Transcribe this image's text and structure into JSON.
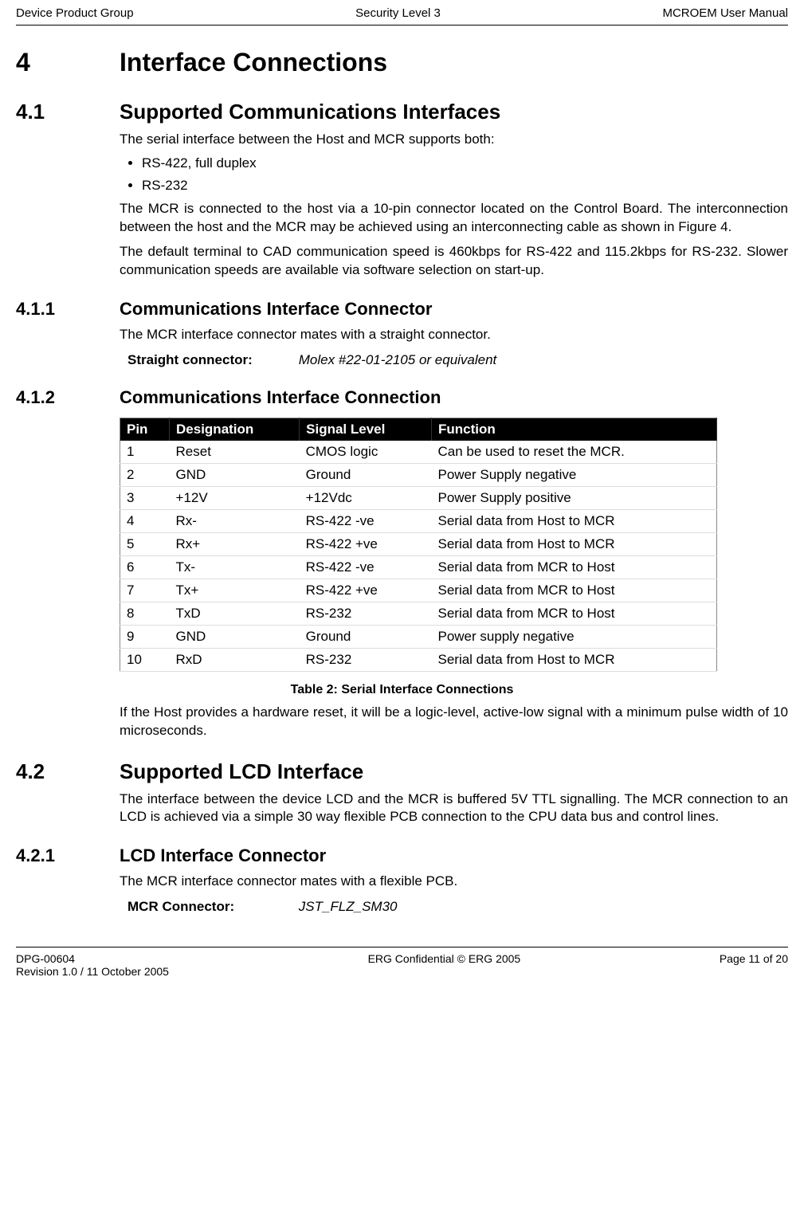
{
  "header": {
    "left": "Device Product Group",
    "center": "Security Level 3",
    "right": "MCROEM User Manual"
  },
  "s4": {
    "num": "4",
    "title": "Interface Connections"
  },
  "s41": {
    "num": "4.1",
    "title": "Supported Communications Interfaces"
  },
  "p41_1": "The serial interface between the Host and MCR supports both:",
  "bullet1": "RS-422, full duplex",
  "bullet2": "RS-232",
  "p41_2": "The MCR is connected to the host via a 10-pin connector located on the Control Board.  The interconnection between the host and the MCR may be achieved using an interconnecting cable as shown in Figure 4.",
  "p41_3": "The default terminal to CAD communication speed is 460kbps for RS-422 and 115.2kbps for RS-232. Slower communication speeds are available via software selection on start-up.",
  "s411": {
    "num": "4.1.1",
    "title": "Communications Interface Connector"
  },
  "p411_1": "The MCR interface connector mates with a straight connector.",
  "spec411": {
    "label": "Straight connector:",
    "value": "Molex #22-01-2105 or equivalent"
  },
  "s412": {
    "num": "4.1.2",
    "title": "Communications Interface Connection"
  },
  "table": {
    "headers": {
      "pin": "Pin",
      "des": "Designation",
      "sig": "Signal Level",
      "func": "Function"
    },
    "rows": [
      {
        "pin": "1",
        "des": "Reset",
        "sig": "CMOS logic",
        "func": "Can be used to reset the MCR."
      },
      {
        "pin": "2",
        "des": "GND",
        "sig": "Ground",
        "func": "Power Supply negative"
      },
      {
        "pin": "3",
        "des": "+12V",
        "sig": "+12Vdc",
        "func": "Power Supply positive"
      },
      {
        "pin": "4",
        "des": "Rx-",
        "sig": "RS-422 -ve",
        "func": "Serial data from Host to MCR"
      },
      {
        "pin": "5",
        "des": "Rx+",
        "sig": "RS-422 +ve",
        "func": "Serial data from Host to MCR"
      },
      {
        "pin": "6",
        "des": "Tx-",
        "sig": "RS-422 -ve",
        "func": "Serial data from MCR to Host"
      },
      {
        "pin": "7",
        "des": "Tx+",
        "sig": "RS-422 +ve",
        "func": "Serial data from MCR to Host"
      },
      {
        "pin": "8",
        "des": "TxD",
        "sig": "RS-232",
        "func": "Serial data from MCR to Host"
      },
      {
        "pin": "9",
        "des": "GND",
        "sig": "Ground",
        "func": "Power supply negative"
      },
      {
        "pin": "10",
        "des": "RxD",
        "sig": "RS-232",
        "func": "Serial data from Host to MCR"
      }
    ],
    "caption": "Table 2: Serial Interface Connections"
  },
  "p412_1": "If the Host provides a hardware reset, it will be a logic-level, active-low signal with a minimum pulse width of 10 microseconds.",
  "s42": {
    "num": "4.2",
    "title": "Supported LCD Interface"
  },
  "p42_1": "The interface between the device LCD and the MCR is buffered 5V TTL signalling. The MCR connection to an LCD is achieved via a simple 30 way flexible PCB connection to the CPU data bus and control lines.",
  "s421": {
    "num": "4.2.1",
    "title": "LCD Interface Connector"
  },
  "p421_1": "The MCR interface connector mates with a flexible PCB.",
  "spec421": {
    "label": "MCR Connector:",
    "value": "JST_FLZ_SM30"
  },
  "footer": {
    "left1": "DPG-00604",
    "left2": "Revision 1.0 / 11 October 2005",
    "center": "ERG Confidential © ERG 2005",
    "right": "Page 11 of 20"
  }
}
